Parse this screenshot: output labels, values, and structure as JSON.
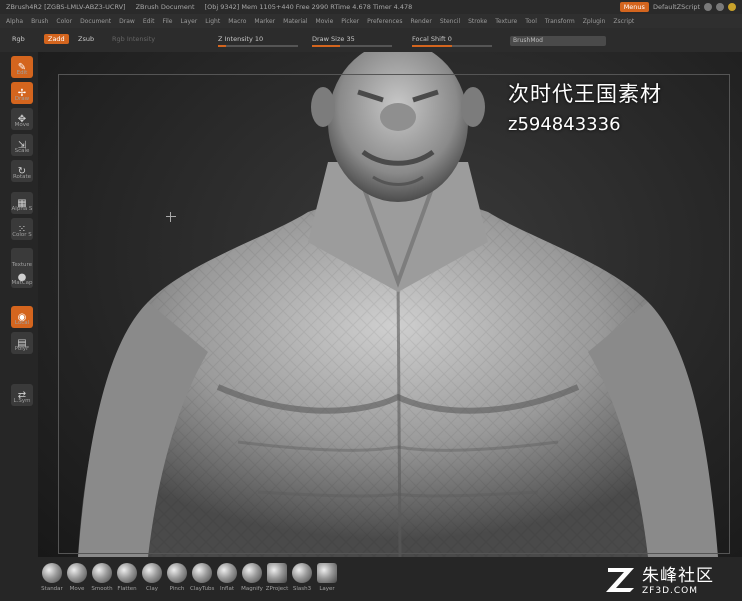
{
  "titlebar": {
    "app": "ZBrush4R2 [ZGBS-LMLV-ABZ3-UCRV]",
    "doc": "ZBrush Document",
    "stats": "[Obj 9342] Mem 1105+440 Free 2990 RTime 4.678 Timer 4.478",
    "menus": "Menus",
    "script": "DefaultZScript"
  },
  "menubar": [
    "Alpha",
    "Brush",
    "Color",
    "Document",
    "Draw",
    "Edit",
    "File",
    "Layer",
    "Light",
    "Macro",
    "Marker",
    "Material",
    "Movie",
    "Picker",
    "Preferences",
    "Render",
    "Stencil",
    "Stroke",
    "Texture",
    "Tool",
    "Transform",
    "Zplugin",
    "Zscript"
  ],
  "toolbar": {
    "rgb": "Rgb",
    "zadd": "Zadd",
    "zsub": "Zsub",
    "rgb_intensity": "Rgb Intensity",
    "z_intensity": "Z Intensity 10",
    "z_intensity_level": 0.1,
    "draw_size": "Draw Size 35",
    "draw_size_level": 0.35,
    "focal_shift": "Focal Shift 0",
    "focal_shift_level": 0.5,
    "brushmod": "BrushMod"
  },
  "sidebar": [
    {
      "label": "Edit",
      "icon": "edit-icon",
      "glyph": "✎",
      "active": true
    },
    {
      "label": "Draw",
      "icon": "draw-icon",
      "glyph": "✢",
      "active": true
    },
    {
      "label": "Move",
      "icon": "move-icon",
      "glyph": "✥",
      "active": false
    },
    {
      "label": "Scale",
      "icon": "scale-icon",
      "glyph": "⇲",
      "active": false
    },
    {
      "label": "Rotate",
      "icon": "rotate-icon",
      "glyph": "↻",
      "active": false
    },
    {
      "label": "Alpha S",
      "icon": "alpha-icon",
      "glyph": "▦",
      "active": false
    },
    {
      "label": "Color S",
      "icon": "color-icon",
      "glyph": "⁙",
      "active": false
    },
    {
      "label": "Texture",
      "icon": "texture-icon",
      "glyph": "",
      "active": false
    },
    {
      "label": "MatCap",
      "icon": "matcap-icon",
      "glyph": "●",
      "active": false
    },
    {
      "label": "Local",
      "icon": "local-icon",
      "glyph": "◉",
      "active": true
    },
    {
      "label": "PolyF",
      "icon": "polyframe-icon",
      "glyph": "▤",
      "active": false
    },
    {
      "label": "L.Sym",
      "icon": "lsym-icon",
      "glyph": "⇄",
      "active": false
    }
  ],
  "watermark": {
    "line1": "次时代王国素材",
    "line2": "z594843336"
  },
  "brushes": [
    "Standar",
    "Move",
    "Smooth",
    "Flatten",
    "Clay",
    "Pinch",
    "ClayTubs",
    "Inflat",
    "Magnify",
    "ZProject",
    "Slash3",
    "Layer"
  ],
  "logo": {
    "cn": "朱峰社区",
    "en": "ZF3D.COM"
  }
}
